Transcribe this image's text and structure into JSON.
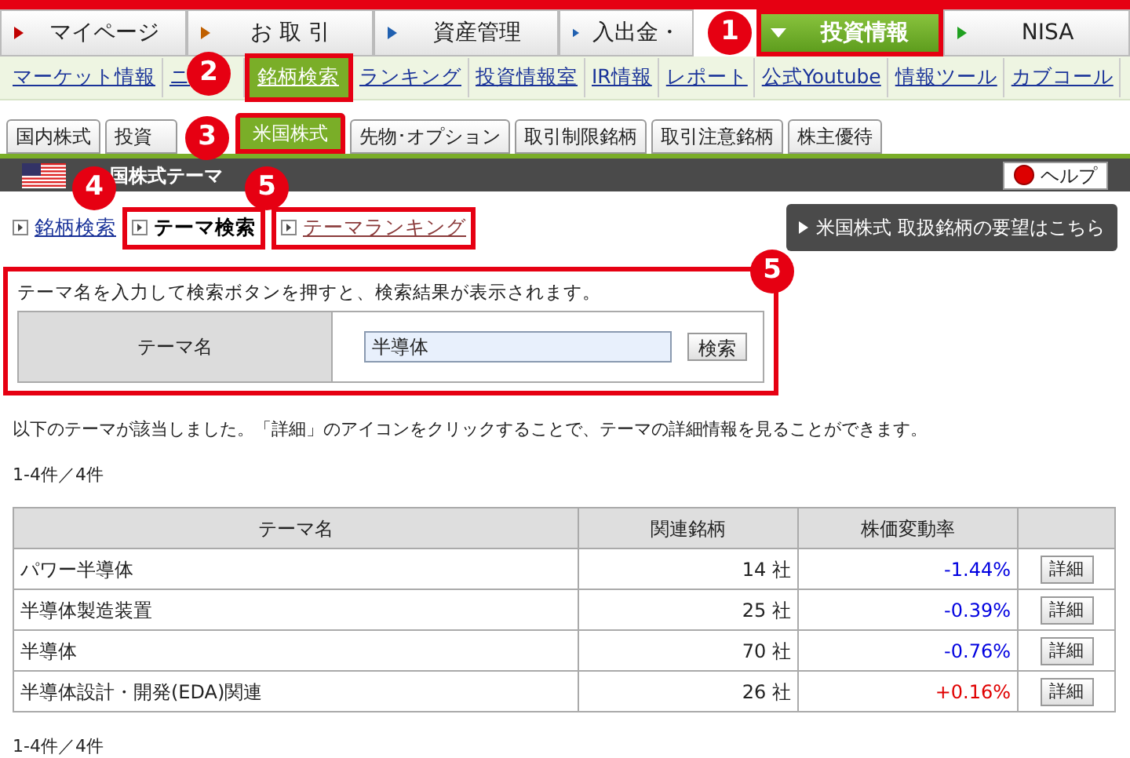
{
  "main_nav": [
    {
      "label": "マイページ",
      "selected": false,
      "annotated": false
    },
    {
      "label": "お 取 引",
      "selected": false,
      "annotated": false
    },
    {
      "label": "資産管理",
      "selected": false,
      "annotated": false
    },
    {
      "label": "入出金・",
      "selected": false,
      "annotated": false
    },
    {
      "label": "投資情報",
      "selected": true,
      "annotated": true
    },
    {
      "label": "NISA",
      "selected": false,
      "annotated": false
    }
  ],
  "sub_nav": [
    {
      "label": "マーケット情報",
      "selected": false,
      "annotated": false
    },
    {
      "label": "ニ",
      "selected": false,
      "annotated": false
    },
    {
      "label": "銘柄検索",
      "selected": true,
      "annotated": true
    },
    {
      "label": "ランキング",
      "selected": false,
      "annotated": false
    },
    {
      "label": "投資情報室",
      "selected": false,
      "annotated": false
    },
    {
      "label": "IR情報",
      "selected": false,
      "annotated": false
    },
    {
      "label": "レポート",
      "selected": false,
      "annotated": false
    },
    {
      "label": "公式Youtube",
      "selected": false,
      "annotated": false
    },
    {
      "label": "情報ツール",
      "selected": false,
      "annotated": false
    },
    {
      "label": "カブコール",
      "selected": false,
      "annotated": false
    }
  ],
  "tabs": [
    {
      "label": "国内株式",
      "selected": false,
      "annotated": false
    },
    {
      "label": "投資",
      "selected": false,
      "annotated": false
    },
    {
      "label": "米国株式",
      "selected": true,
      "annotated": true
    },
    {
      "label": "先物･オプション",
      "selected": false,
      "annotated": false
    },
    {
      "label": "取引制限銘柄",
      "selected": false,
      "annotated": false
    },
    {
      "label": "取引注意銘柄",
      "selected": false,
      "annotated": false
    },
    {
      "label": "株主優待",
      "selected": false,
      "annotated": false
    }
  ],
  "header": {
    "title": "国株式テーマ",
    "help": "ヘルプ"
  },
  "search_links": [
    {
      "label": "銘柄検索",
      "selected": false,
      "annotated": false
    },
    {
      "label": "テーマ検索",
      "selected": true,
      "annotated": true
    },
    {
      "label": "テーマランキング",
      "selected": false,
      "annotated": true
    }
  ],
  "request_button": "米国株式 取扱銘柄の要望はこちら",
  "search": {
    "annotated": true,
    "instruction": "テーマ名を入力して検索ボタンを押すと、検索結果が表示されます。",
    "label": "テーマ名",
    "value": "半導体",
    "button": "検索"
  },
  "result_message": "以下のテーマが該当しました。「詳細」のアイコンをクリックすることで、テーマの詳細情報を見ることができます。",
  "count_top": "1-4件／4件",
  "table": {
    "columns": [
      "テーマ名",
      "関連銘柄",
      "株価変動率"
    ],
    "rows": [
      {
        "name": "パワー半導体",
        "stocks": "14 社",
        "change": "-1.44%",
        "color": "#0000e0",
        "detail": "詳細"
      },
      {
        "name": "半導体製造装置",
        "stocks": "25 社",
        "change": "-0.39%",
        "color": "#0000e0",
        "detail": "詳細"
      },
      {
        "name": "半導体",
        "stocks": "70 社",
        "change": "-0.76%",
        "color": "#0000e0",
        "detail": "詳細"
      },
      {
        "name": "半導体設計・開発(EDA)関連",
        "stocks": "26 社",
        "change": "+0.16%",
        "color": "#e00000",
        "detail": "詳細"
      }
    ]
  },
  "count_bottom": "1-4件／4件",
  "annotations": [
    {
      "label": "1"
    },
    {
      "label": "2"
    },
    {
      "label": "3"
    },
    {
      "label": "4"
    },
    {
      "label": "5"
    },
    {
      "label": "5"
    }
  ]
}
